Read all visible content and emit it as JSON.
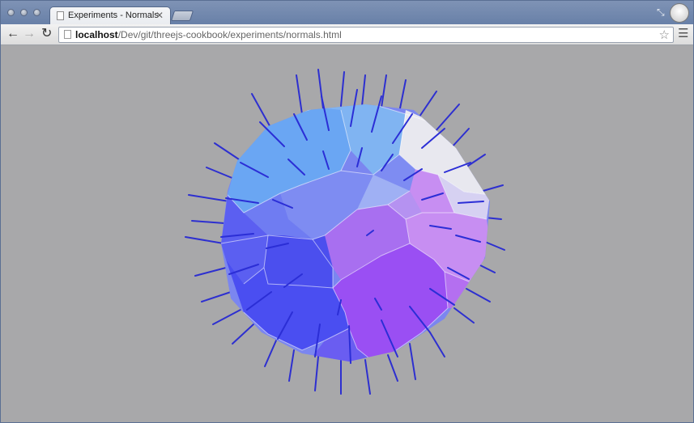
{
  "window": {
    "tab": {
      "title": "Experiments - Normals",
      "close_icon": "close-icon",
      "page_icon": "document-icon"
    }
  },
  "toolbar": {
    "back_icon": "arrow-left-icon",
    "forward_icon": "arrow-right-icon",
    "reload_icon": "reload-icon",
    "url_host": "localhost",
    "url_path": "/Dev/git/threejs-cookbook/experiments/normals.html",
    "bookmark_icon": "star-icon",
    "menu_icon": "hamburger-menu-icon"
  },
  "scene": {
    "background": "#a9a9ab",
    "object": "sphere with normal vectors",
    "normal_color": "#2b2ed6",
    "colors": [
      "#6aa6f3",
      "#5a5ff2",
      "#9b4ff2",
      "#c98bf1",
      "#e8e8ee"
    ]
  }
}
